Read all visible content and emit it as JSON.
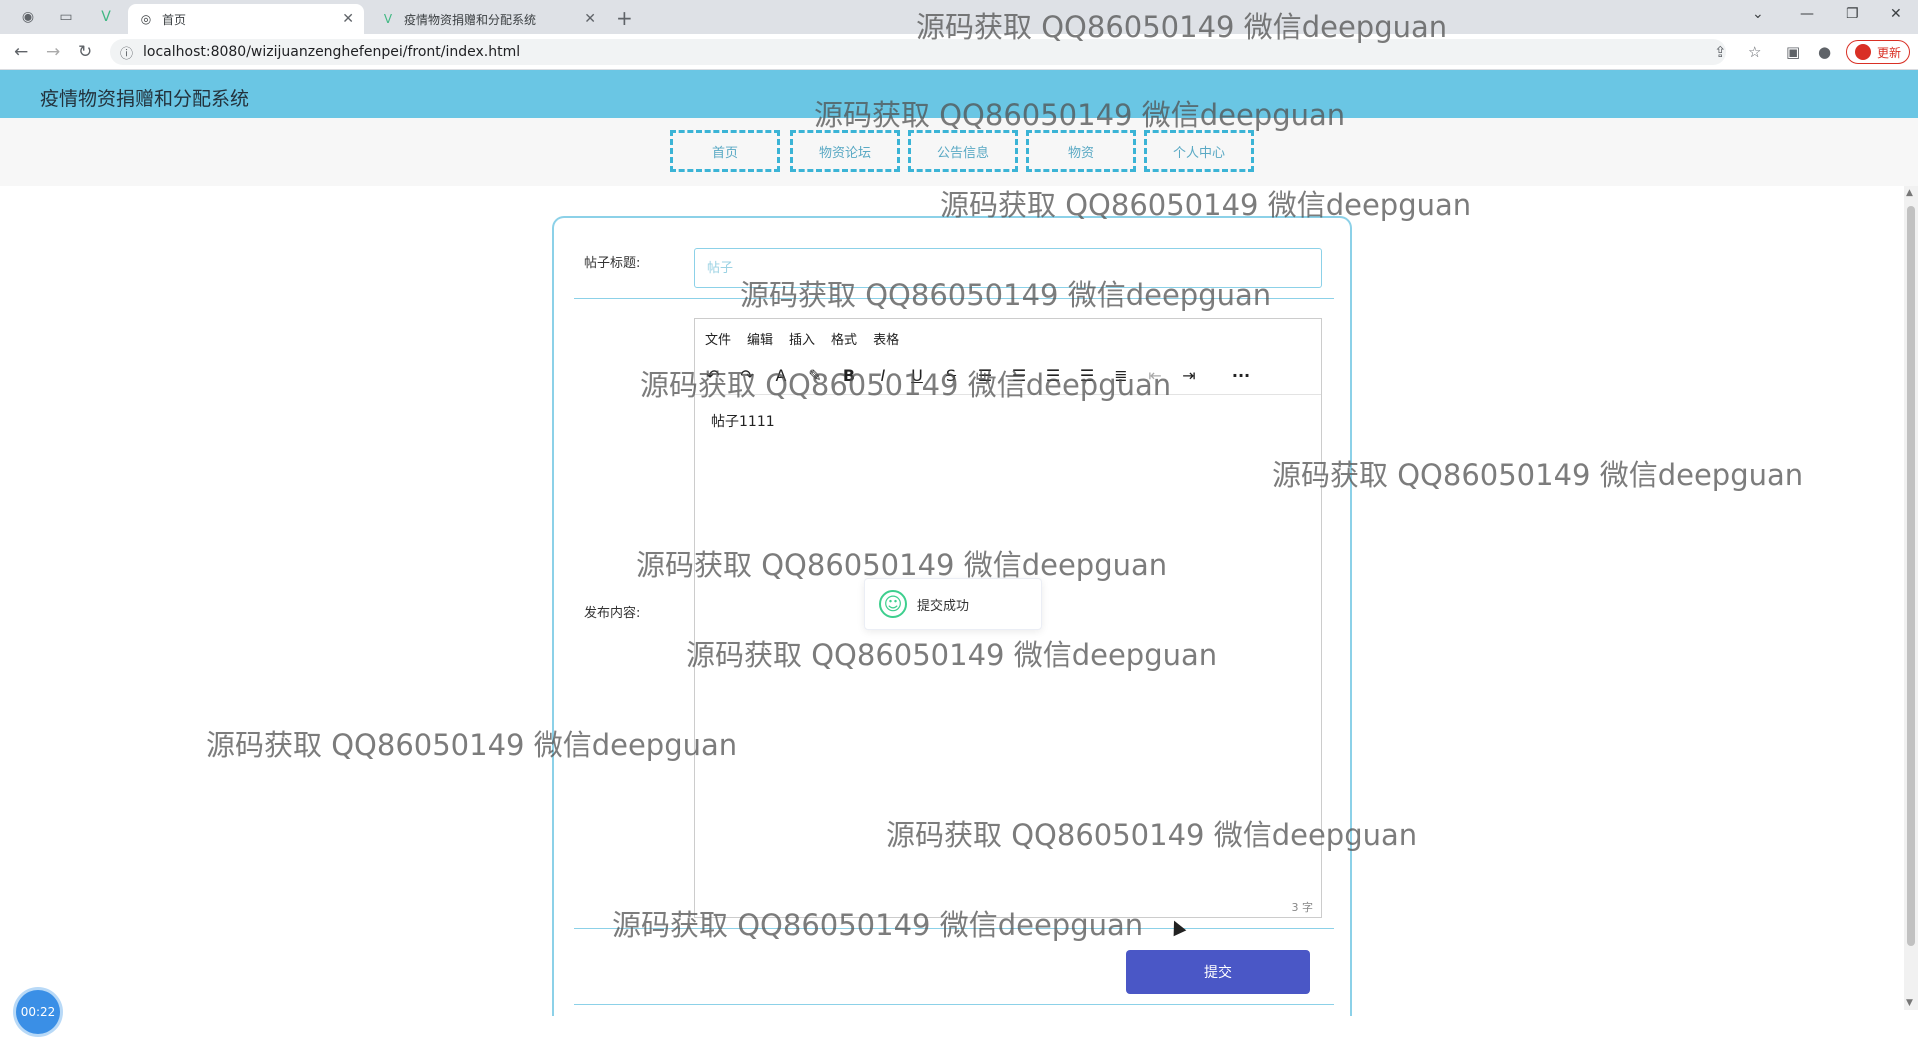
{
  "browser": {
    "tabs": [
      {
        "title": "首页",
        "active": true
      },
      {
        "title": "疫情物资捐赠和分配系统",
        "active": false
      }
    ],
    "url": "localhost:8080/wizijuanzenghefenpei/front/index.html",
    "update_label": "更新"
  },
  "app": {
    "title": "疫情物资捐赠和分配系统",
    "nav": [
      "首页",
      "物资论坛",
      "公告信息",
      "物资",
      "个人中心"
    ]
  },
  "form": {
    "title_label": "帖子标题:",
    "title_placeholder": "帖子",
    "content_label": "发布内容:",
    "editor_menu": [
      "文件",
      "编辑",
      "插入",
      "格式",
      "表格"
    ],
    "editor_content": "帖子1111",
    "word_count": "3 字",
    "submit_label": "提交"
  },
  "toast": {
    "message": "提交成功"
  },
  "timer": "00:22",
  "watermark": "源码获取 QQ86050149 微信deepguan"
}
